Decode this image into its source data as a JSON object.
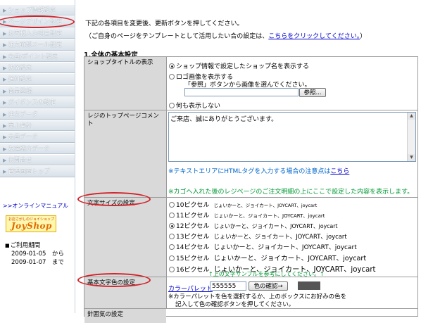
{
  "sidebar": {
    "items": [
      {
        "label": "ショップ情報設定"
      },
      {
        "label": "ページデザイン設定"
      },
      {
        "label": "お客様入力項目設定"
      },
      {
        "label": "注文確認メール設定"
      },
      {
        "label": "会員/ポイント設定"
      },
      {
        "label": "決済設定"
      },
      {
        "label": "送料設定"
      },
      {
        "label": "商品登録"
      },
      {
        "label": "ガイダンスの設定"
      },
      {
        "label": "注文データ"
      },
      {
        "label": "売上集計"
      },
      {
        "label": "会員データ"
      },
      {
        "label": "友達紹介データ"
      },
      {
        "label": "お問合せ"
      },
      {
        "label": "管理画面トップ"
      }
    ],
    "manual_link": ">>オンラインマニュアル",
    "logo": {
      "small_text": "お店さがしのジョイショップ",
      "big_text": "JoyShop"
    },
    "period": {
      "label": "ご利用期間",
      "from": "2009-01-05　から",
      "to": "2009-01-07　まで"
    }
  },
  "main": {
    "intro1": "下記の各項目を変更後、更新ボタンを押してください。",
    "intro2_prefix": "（ご自身のページをテンプレートとして活用したい合の設定は、",
    "intro2_link": "こちらをクリックしてください。",
    "intro2_suffix": "）",
    "section_title": "1.全体の基本設定",
    "shop_title": {
      "label": "ショップタイトルの表示",
      "opt1": "ショップ情報で設定したショップ名を表示する",
      "opt2": "ロゴ画像を表示する",
      "opt2_hint": "「参照」ボタンから画像を選んでください。",
      "browse_button": "参照...",
      "opt3": "何も表示しない"
    },
    "register_comment": {
      "label": "レジのトップページコメント",
      "value": "ご来店、誠にありがとうございます。",
      "note1_prefix": "※テキストエリアにHTMLタグを入力する場合の注意点は",
      "note1_link": "こちら",
      "note2": "※カゴへ入れた後のレジページのご注文明細の上にここで設定した内容を表示します。"
    },
    "font_size": {
      "label": "文字サイズの設定",
      "sample": "じょいかーと、ジョイカート、JOYCART、joycart",
      "options": [
        {
          "label": "10ピクセル",
          "selected": false
        },
        {
          "label": "11ピクセル",
          "selected": false
        },
        {
          "label": "12ピクセル",
          "selected": true
        },
        {
          "label": "13ピクセル",
          "selected": false
        },
        {
          "label": "14ピクセル",
          "selected": false
        },
        {
          "label": "15ピクセル",
          "selected": false
        },
        {
          "label": "16ピクセル",
          "selected": false
        }
      ],
      "hint": "↑上の文字サンプルを参考にしてください。↑"
    },
    "text_color": {
      "label": "基本文字色の設定",
      "palette_link": "カラーパレット",
      "value": "555555",
      "confirm_button": "色の確認→",
      "swatch_color": "#555555",
      "note_line1": "※カラーパレットを色を選択するか、上のボックスにお好みの色を",
      "note_line2": "記入して色の確認ボタンを押してください。"
    },
    "next_row_label": "針囲気の設定"
  },
  "colors": {
    "circle": "#d2232a",
    "link": "#0000cc",
    "note_blue": "#0066cc",
    "note_green": "#009933"
  }
}
